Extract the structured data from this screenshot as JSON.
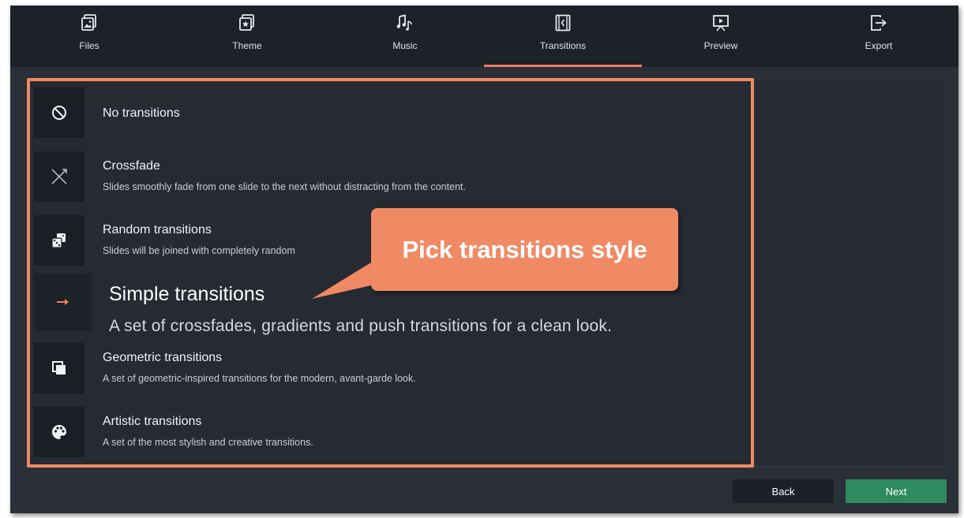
{
  "tabs": [
    {
      "label": "Files",
      "icon": "files-icon"
    },
    {
      "label": "Theme",
      "icon": "theme-icon"
    },
    {
      "label": "Music",
      "icon": "music-icon"
    },
    {
      "label": "Transitions",
      "icon": "transitions-icon",
      "active": true
    },
    {
      "label": "Preview",
      "icon": "preview-icon"
    },
    {
      "label": "Export",
      "icon": "export-icon"
    }
  ],
  "transitions": [
    {
      "title": "No transitions",
      "description": "",
      "icon": "no-entry-icon"
    },
    {
      "title": "Crossfade",
      "description": "Slides smoothly fade from one slide to the next without distracting from the content.",
      "icon": "crossfade-icon"
    },
    {
      "title": "Random transitions",
      "description": "Slides will be joined with completely random",
      "icon": "dice-icon"
    },
    {
      "title": "Simple transitions",
      "description": "A set of crossfades, gradients and push transitions for a clean look.",
      "icon": "arrow-right-icon"
    },
    {
      "title": "Geometric transitions",
      "description": "A set of geometric-inspired transitions for the modern, avant-garde look.",
      "icon": "squares-icon"
    },
    {
      "title": "Artistic transitions",
      "description": "A set of the most stylish and creative transitions.",
      "icon": "palette-icon"
    }
  ],
  "callout": {
    "text": "Pick transitions style"
  },
  "buttons": {
    "back": "Back",
    "next": "Next"
  },
  "colors": {
    "accent": "#f08a65",
    "next_button": "#2e8b5f",
    "background": "#2a2f38",
    "tabbar": "#1d2128"
  }
}
